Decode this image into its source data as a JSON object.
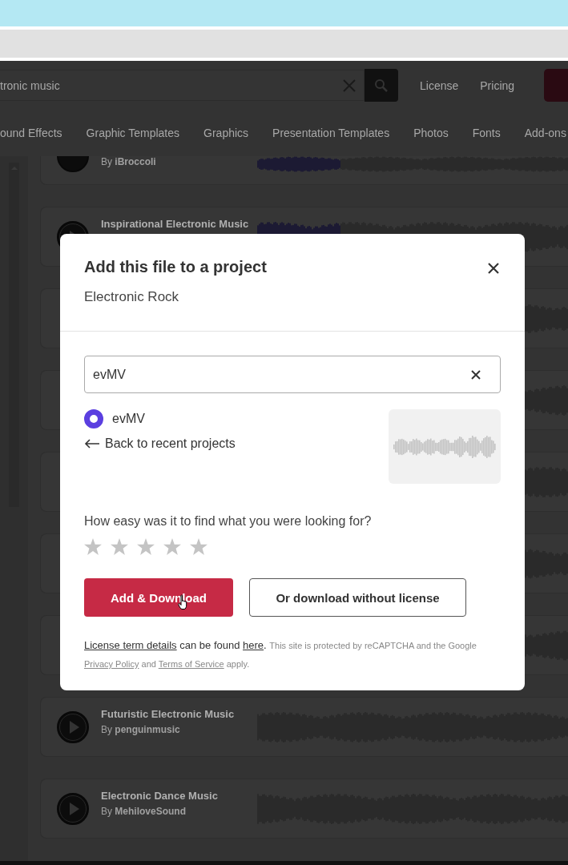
{
  "header": {
    "search_value": "tronic music",
    "nav_links": [
      "License",
      "Pricing"
    ]
  },
  "categories": [
    "ound Effects",
    "Graphic Templates",
    "Graphics",
    "Presentation Templates",
    "Photos",
    "Fonts",
    "Add-ons"
  ],
  "tracks": [
    {
      "kind": "partial",
      "artist_prefix": "By",
      "artist": "iBroccoli",
      "level": 0.27
    },
    {
      "kind": "full",
      "title": "Inspirational Electronic Music",
      "level": 0.27
    },
    {
      "kind": "covered"
    },
    {
      "kind": "covered"
    },
    {
      "kind": "covered"
    },
    {
      "kind": "covered"
    },
    {
      "kind": "covered"
    },
    {
      "kind": "full",
      "title": "Futuristic Electronic Music",
      "artist_prefix": "By",
      "artist": "penguinmusic"
    },
    {
      "kind": "full",
      "title": "Electronic Dance Music",
      "artist_prefix": "By",
      "artist": "MehiloveSound"
    }
  ],
  "modal": {
    "title": "Add this file to a project",
    "subtitle": "Electronic Rock",
    "project_search": {
      "value": "evMV"
    },
    "projects": [
      {
        "name": "evMV",
        "selected": true
      }
    ],
    "back_link": "Back to recent projects",
    "question": "How easy was it to find what you were looking for?",
    "stars": 0,
    "primary_button": "Add & Download",
    "secondary_button": "Or download without license",
    "footer": [
      {
        "kind": "link",
        "text": "License term details"
      },
      {
        "kind": "text",
        "text": " can be found "
      },
      {
        "kind": "link",
        "text": "here"
      },
      {
        "kind": "text",
        "text": ". "
      },
      {
        "kind": "fine",
        "text": "This site is protected by reCAPTCHA and the Google "
      },
      {
        "kind": "fine_link",
        "text": "Privacy Policy"
      },
      {
        "kind": "fine",
        "text": " and "
      },
      {
        "kind": "fine_link",
        "text": "Terms of Service"
      },
      {
        "kind": "fine",
        "text": " apply."
      }
    ]
  }
}
